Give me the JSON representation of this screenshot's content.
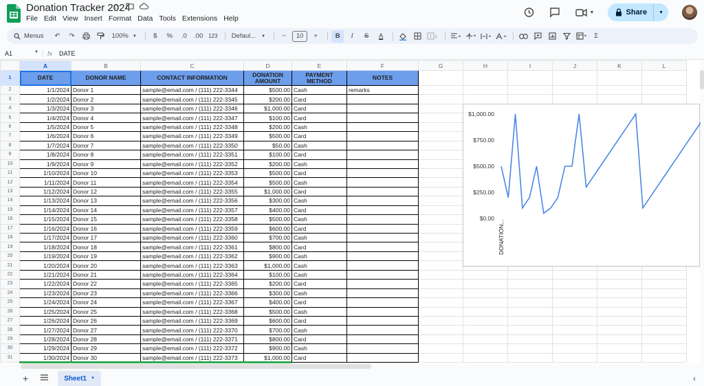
{
  "app": {
    "doc_title": "Donation Tracker 2024",
    "menu": [
      "File",
      "Edit",
      "View",
      "Insert",
      "Format",
      "Data",
      "Tools",
      "Extensions",
      "Help"
    ],
    "share_label": "Share"
  },
  "toolbar": {
    "menus_label": "Menus",
    "zoom": "100%",
    "currency": "$",
    "percent": "%",
    "dec_decrease": ".0",
    "dec_increase": ".00",
    "number_format": "123",
    "font": "Defaul...",
    "font_size": "10",
    "bold": "B",
    "italic": "I",
    "strike": "S",
    "text_color": "A",
    "sum": "Σ"
  },
  "formula_bar": {
    "cell_ref": "A1",
    "fx": "fx",
    "content": "DATE"
  },
  "columns": [
    "A",
    "B",
    "C",
    "D",
    "E",
    "F",
    "G",
    "H",
    "I",
    "J",
    "K",
    "L"
  ],
  "headers": [
    "DATE",
    "DONOR NAME",
    "CONTACT INFORMATION",
    "DONATION AMOUNT",
    "PAYMENT METHOD",
    "NOTES"
  ],
  "rows": [
    [
      "1/1/2024",
      "Donor 1",
      "sample@email.com / (111) 222-3344",
      "$500.00",
      "Cash",
      "remarks"
    ],
    [
      "1/2/2024",
      "Donor 2",
      "sample@email.com / (111) 222-3345",
      "$200.00",
      "Card",
      ""
    ],
    [
      "1/3/2024",
      "Donor 3",
      "sample@email.com / (111) 222-3346",
      "$1,000.00",
      "Card",
      ""
    ],
    [
      "1/4/2024",
      "Donor 4",
      "sample@email.com / (111) 222-3347",
      "$100.00",
      "Card",
      ""
    ],
    [
      "1/5/2024",
      "Donor 5",
      "sample@email.com / (111) 222-3348",
      "$200.00",
      "Cash",
      ""
    ],
    [
      "1/6/2024",
      "Donor 6",
      "sample@email.com / (111) 222-3349",
      "$500.00",
      "Card",
      ""
    ],
    [
      "1/7/2024",
      "Donor 7",
      "sample@email.com / (111) 222-3350",
      "$50.00",
      "Cash",
      ""
    ],
    [
      "1/8/2024",
      "Donor 8",
      "sample@email.com / (111) 222-3351",
      "$100.00",
      "Card",
      ""
    ],
    [
      "1/9/2024",
      "Donor 9",
      "sample@email.com / (111) 222-3352",
      "$200.00",
      "Cash",
      ""
    ],
    [
      "1/10/2024",
      "Donor 10",
      "sample@email.com / (111) 222-3353",
      "$500.00",
      "Card",
      ""
    ],
    [
      "1/11/2024",
      "Donor 11",
      "sample@email.com / (111) 222-3354",
      "$500.00",
      "Cash",
      ""
    ],
    [
      "1/12/2024",
      "Donor 12",
      "sample@email.com / (111) 222-3355",
      "$1,000.00",
      "Card",
      ""
    ],
    [
      "1/13/2024",
      "Donor 13",
      "sample@email.com / (111) 222-3356",
      "$300.00",
      "Cash",
      ""
    ],
    [
      "1/14/2024",
      "Donor 14",
      "sample@email.com / (111) 222-3357",
      "$400.00",
      "Card",
      ""
    ],
    [
      "1/15/2024",
      "Donor 15",
      "sample@email.com / (111) 222-3358",
      "$500.00",
      "Cash",
      ""
    ],
    [
      "1/16/2024",
      "Donor 16",
      "sample@email.com / (111) 222-3359",
      "$600.00",
      "Card",
      ""
    ],
    [
      "1/17/2024",
      "Donor 17",
      "sample@email.com / (111) 222-3360",
      "$700.00",
      "Cash",
      ""
    ],
    [
      "1/18/2024",
      "Donor 18",
      "sample@email.com / (111) 222-3361",
      "$800.00",
      "Card",
      ""
    ],
    [
      "1/19/2024",
      "Donor 19",
      "sample@email.com / (111) 222-3362",
      "$900.00",
      "Cash",
      ""
    ],
    [
      "1/20/2024",
      "Donor 20",
      "sample@email.com / (111) 222-3363",
      "$1,000.00",
      "Cash",
      ""
    ],
    [
      "1/21/2024",
      "Donor 21",
      "sample@email.com / (111) 222-3364",
      "$100.00",
      "Cash",
      ""
    ],
    [
      "1/22/2024",
      "Donor 22",
      "sample@email.com / (111) 222-3365",
      "$200.00",
      "Card",
      ""
    ],
    [
      "1/23/2024",
      "Donor 23",
      "sample@email.com / (111) 222-3366",
      "$300.00",
      "Cash",
      ""
    ],
    [
      "1/24/2024",
      "Donor 24",
      "sample@email.com / (111) 222-3367",
      "$400.00",
      "Card",
      ""
    ],
    [
      "1/25/2024",
      "Donor 25",
      "sample@email.com / (111) 222-3368",
      "$500.00",
      "Cash",
      ""
    ],
    [
      "1/26/2024",
      "Donor 26",
      "sample@email.com / (111) 222-3369",
      "$600.00",
      "Card",
      ""
    ],
    [
      "1/27/2024",
      "Donor 27",
      "sample@email.com / (111) 222-3370",
      "$700.00",
      "Cash",
      ""
    ],
    [
      "1/28/2024",
      "Donor 28",
      "sample@email.com / (111) 222-3371",
      "$800.00",
      "Card",
      ""
    ],
    [
      "1/29/2024",
      "Donor 29",
      "sample@email.com / (111) 222-3372",
      "$900.00",
      "Cash",
      ""
    ],
    [
      "1/30/2024",
      "Donor 30",
      "sample@email.com / (111) 222-3373",
      "$1,000.00",
      "Card",
      ""
    ]
  ],
  "chart_data": {
    "type": "line",
    "y_ticks": [
      "$1,000.00",
      "$750.00",
      "$500.00",
      "$250.00",
      "$0.00"
    ],
    "ylim": [
      0,
      1000
    ],
    "x_axis_label": "DONATION...",
    "values": [
      500,
      200,
      1000,
      100,
      200,
      500,
      50,
      100,
      200,
      500,
      500,
      1000,
      300,
      400,
      500,
      600,
      700,
      800,
      900,
      1000,
      100,
      200,
      300,
      400,
      500,
      600,
      700,
      800,
      900,
      1000
    ],
    "line_color": "#4a86e8",
    "grid": false
  },
  "bottom": {
    "sheet_tab": "Sheet1"
  },
  "colors": {
    "header_fill": "#6d9eeb",
    "selection": "#1a73e8",
    "share_bg": "#c2e7ff"
  }
}
